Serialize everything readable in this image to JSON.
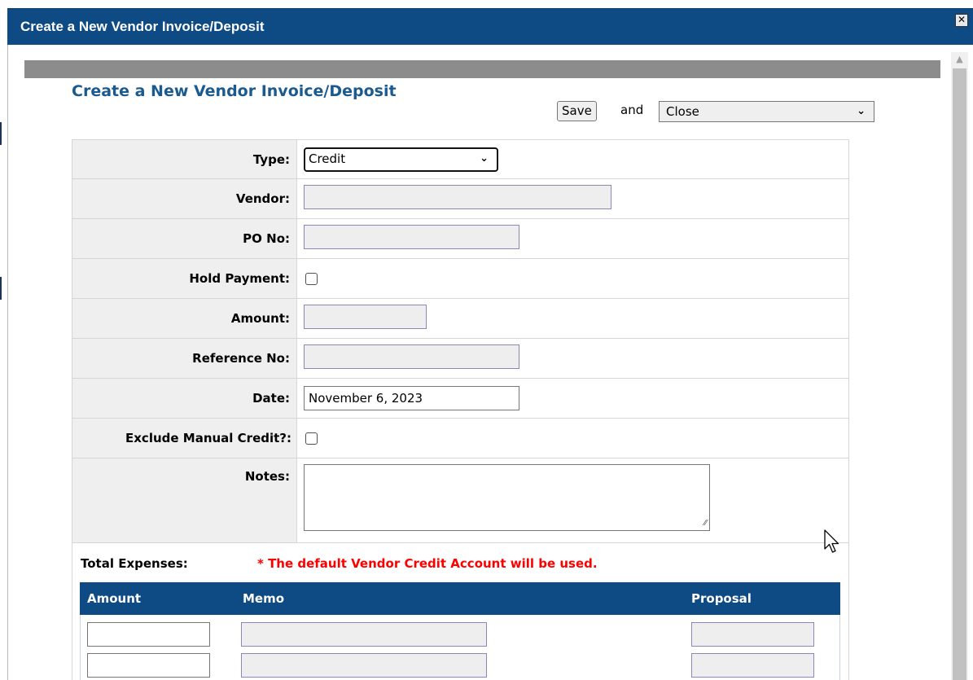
{
  "window": {
    "title": "Create a New Vendor Invoice/Deposit",
    "close_glyph": "✕"
  },
  "form": {
    "heading": "Create a New Vendor Invoice/Deposit",
    "save_label": "Save",
    "and_label": "and",
    "after_save_selected": "Close",
    "fields": {
      "type_label": "Type:",
      "type_value": "Credit",
      "vendor_label": "Vendor:",
      "vendor_value": "",
      "po_label": "PO No:",
      "po_value": "",
      "hold_label": "Hold Payment:",
      "hold_checked": false,
      "amount_label": "Amount:",
      "amount_value": "",
      "reference_label": "Reference No:",
      "reference_value": "",
      "date_label": "Date:",
      "date_value": "November 6, 2023",
      "exclude_label": "Exclude Manual Credit?:",
      "exclude_checked": false,
      "notes_label": "Notes:",
      "notes_value": ""
    }
  },
  "expenses": {
    "title": "Total Expenses:",
    "note": "* The default Vendor Credit Account will be used.",
    "columns": [
      "Amount",
      "Memo",
      "Proposal"
    ],
    "rows": [
      {
        "amount": "",
        "memo": "",
        "proposal": ""
      },
      {
        "amount": "",
        "memo": "",
        "proposal": ""
      }
    ]
  },
  "colors": {
    "header_blue": "#0e4a84",
    "heading_blue": "#1a5a8f",
    "warning_red": "#ff0000"
  },
  "icons": {
    "close": "close-icon",
    "select_caret": "chevron-down-icon",
    "scroll_up": "scroll-up-arrow-icon",
    "cursor": "mouse-pointer-icon",
    "resize": "resize-grip-icon"
  }
}
